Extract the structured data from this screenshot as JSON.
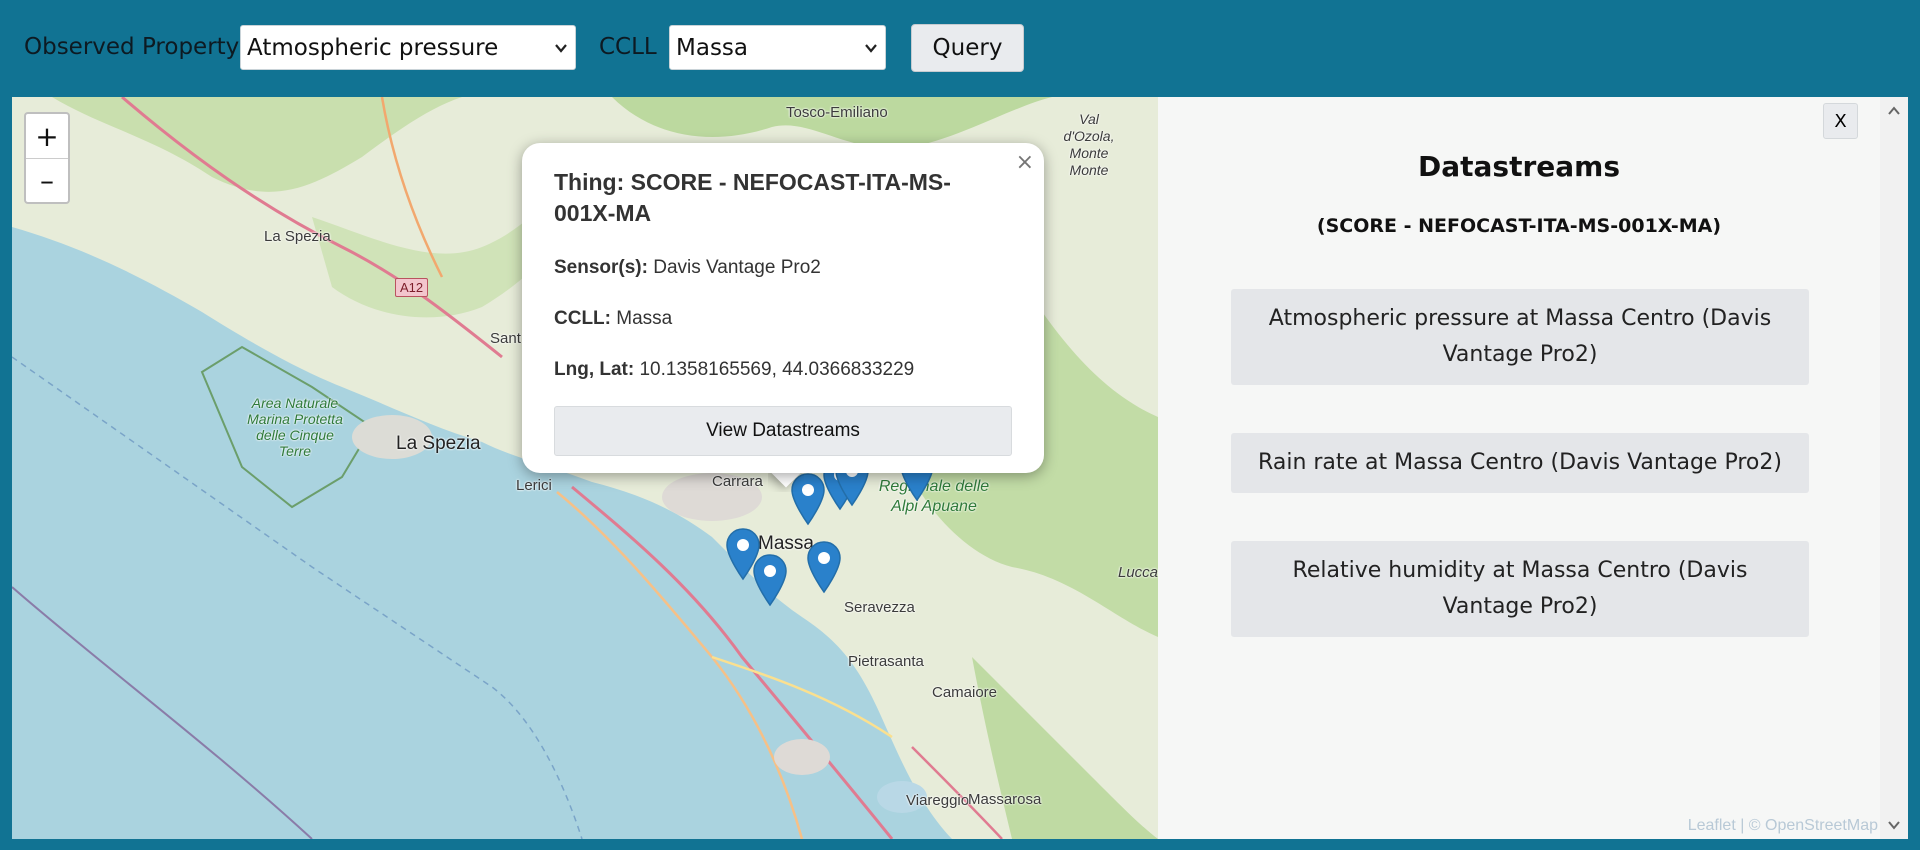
{
  "toolbar": {
    "observed_property_label": "Observed Property",
    "observed_property_value": "Atmospheric pressure",
    "ccll_label": "CCLL",
    "ccll_value": "Massa",
    "query_label": "Query"
  },
  "map": {
    "zoom_in": "+",
    "zoom_out": "–",
    "places": {
      "tosco": "Tosco-Emiliano",
      "laspezia_small": "La Spezia",
      "a12": "A12",
      "santo": "Sant",
      "park": "Area Naturale Marina Protetta delle Cinque Terre",
      "laspezia": "La Spezia",
      "lerici": "Lerici",
      "carrara": "Carrara",
      "massa": "Massa",
      "alpi": "Parco Naturale Regionale delle Alpi Apuane",
      "lucca": "Lucca",
      "seravezza": "Seravezza",
      "pietrasanta": "Pietrasanta",
      "camaiore": "Camaiore",
      "viareggio": "Viareggio",
      "massarosa": "Massarosa",
      "valdozola": "Val d'Ozola, Monte Monte"
    },
    "marker_color": "#2a81cb"
  },
  "popup": {
    "title": "Thing: SCORE - NEFOCAST-ITA-MS-001X-MA",
    "sensor_label": "Sensor(s):",
    "sensor_value": "Davis Vantage Pro2",
    "ccll_label": "CCLL:",
    "ccll_value": "Massa",
    "lnglat_label": "Lng, Lat:",
    "lnglat_value": "10.1358165569, 44.0366833229",
    "button": "View Datastreams",
    "close": "×"
  },
  "panel": {
    "close": "X",
    "title": "Datastreams",
    "subtitle": "(SCORE - NEFOCAST-ITA-MS-001X-MA)",
    "datastreams": [
      "Atmospheric pressure at Massa Centro (Davis Vantage Pro2)",
      "Rain rate at Massa Centro (Davis Vantage Pro2)",
      "Relative humidity at Massa Centro (Davis Vantage Pro2)"
    ],
    "attribution": "Leaflet | © OpenStreetMap"
  }
}
